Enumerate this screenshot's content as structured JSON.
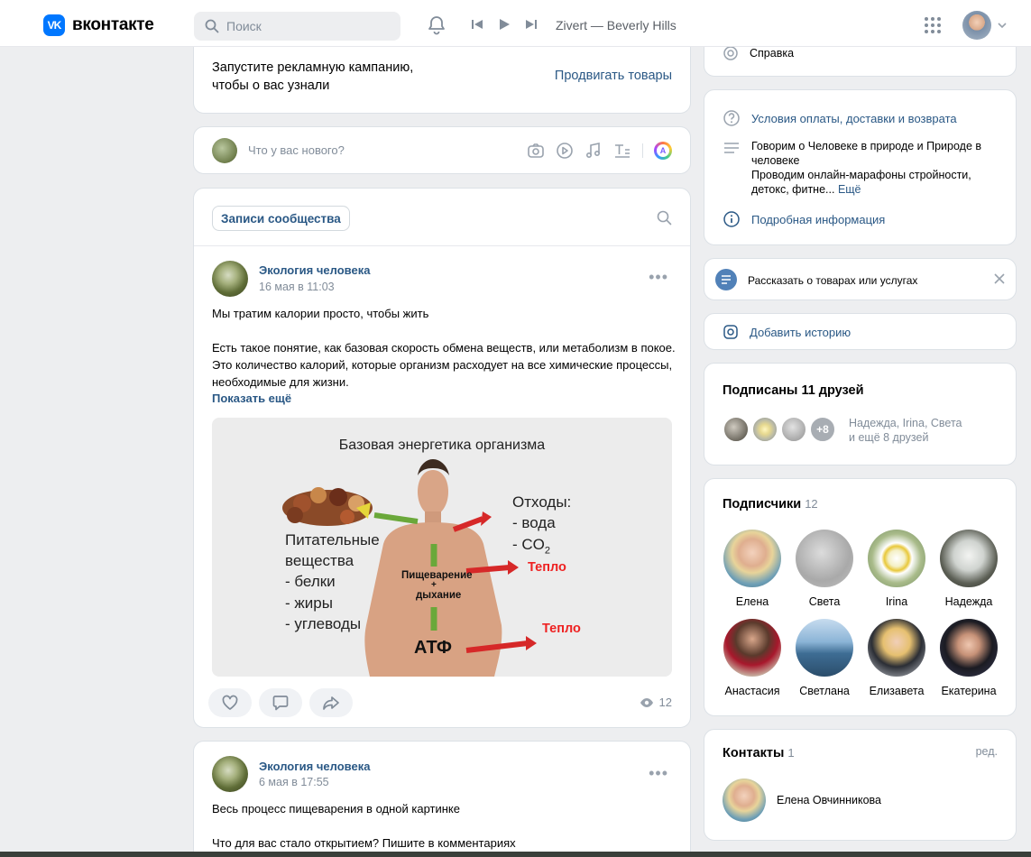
{
  "header": {
    "logo_glyph": "VK",
    "logo_text": "вконтакте",
    "search_placeholder": "Поиск",
    "track": "Zivert — Beverly Hills"
  },
  "feed": {
    "promo": {
      "text": "Запустите рекламную кампанию, чтобы о вас узнали",
      "link": "Продвигать товары"
    },
    "composer": {
      "placeholder": "Что у вас нового?",
      "ai_label": "A"
    },
    "tab": "Записи сообщества",
    "posts": [
      {
        "author": "Экология человека",
        "date": "16 мая в 11:03",
        "text1": "Мы тратим калории просто, чтобы жить",
        "text2": "Есть такое понятие, как базовая скорость обмена веществ, или метаболизм в покое. Это количество калорий, которые организм расходует на все химические процессы, необходимые для жизни.",
        "show_more": "Показать ещё",
        "views": "12",
        "image": {
          "title": "Базовая энергетика организма",
          "waste_title": "Отходы:",
          "waste_water": "- вода",
          "waste_co2": "- CO",
          "waste_co2_sub": "2",
          "heat1": "Тепло",
          "heat2": "Тепло",
          "nutrients": [
            "Питательные",
            "вещества",
            "- белки",
            "- жиры",
            "- углеводы"
          ],
          "digestion": "Пищеварение",
          "plus": "+",
          "breathing": "дыхание",
          "atp": "АТФ"
        }
      },
      {
        "author": "Экология человека",
        "date": "6 мая в 17:55",
        "text1": "Весь процесс пищеварения в одной картинке",
        "text2": "Что для вас стало открытием? Пишите в комментариях"
      }
    ]
  },
  "sidebar": {
    "help": "Справка",
    "info": {
      "terms": "Условия оплаты, доставки и возврата",
      "desc1": "Говорим о Человеке в природе и Природе в человеке",
      "desc2": "Проводим онлайн-марафоны стройности, детокс, фитне...",
      "desc_more": "Ещё",
      "details": "Подробная информация"
    },
    "tell": "Рассказать о товарах или услугах",
    "story": "Добавить историю",
    "friends": {
      "title": "Подписаны 11 друзей",
      "extra": "+8",
      "line1": "Надежда, Irina, Света",
      "line2": "и ещё 8 друзей"
    },
    "followers": {
      "title": "Подписчики",
      "count": "12",
      "people": [
        "Елена",
        "Света",
        "Irina",
        "Надежда",
        "Анастасия",
        "Светлана",
        "Елизавета",
        "Екатерина"
      ]
    },
    "contacts": {
      "title": "Контакты",
      "count": "1",
      "edit": "ред.",
      "name": "Елена Овчинникова"
    }
  }
}
